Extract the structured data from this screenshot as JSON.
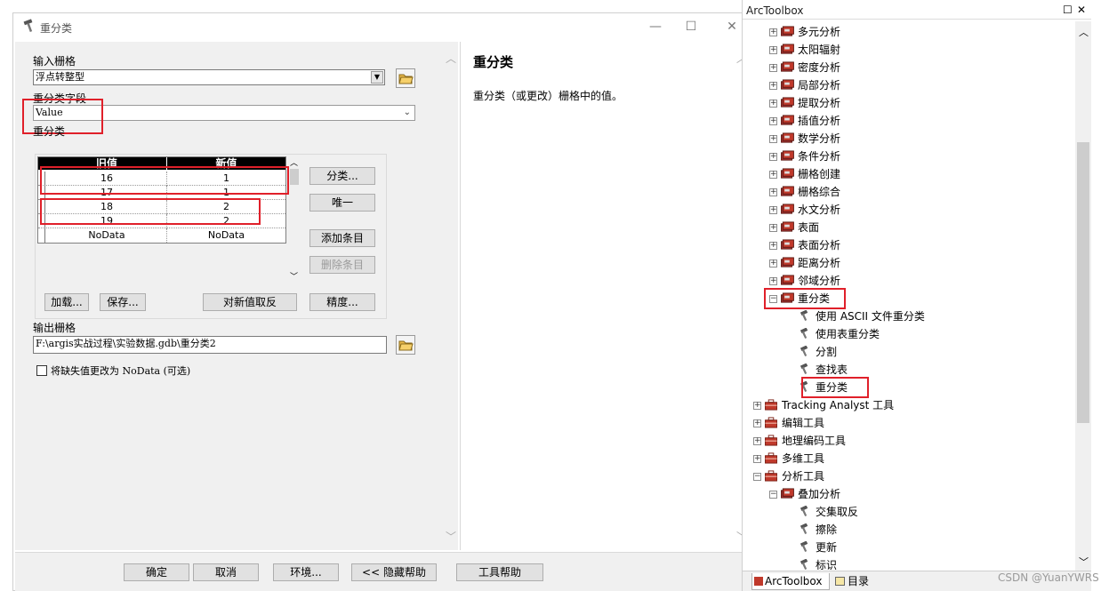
{
  "dialog": {
    "title": "重分类",
    "input_raster_label": "输入栅格",
    "input_raster_value": "浮点转整型",
    "reclass_field_label": "重分类字段",
    "reclass_field_value": "Value",
    "reclassification_label": "重分类",
    "table_headers": [
      "旧值",
      "新值"
    ],
    "table_rows": [
      {
        "old": "16",
        "new": "1"
      },
      {
        "old": "17",
        "new": "1"
      },
      {
        "old": "18",
        "new": "2"
      },
      {
        "old": "19",
        "new": "2"
      },
      {
        "old": "NoData",
        "new": "NoData"
      }
    ],
    "buttons": {
      "classify": "分类...",
      "unique": "唯一",
      "add_entry": "添加条目",
      "delete_entry": "删除条目",
      "load": "加载...",
      "save": "保存...",
      "reverse": "对新值取反",
      "precision": "精度..."
    },
    "output_raster_label": "输出栅格",
    "output_raster_value": "F:\\argis实战过程\\实验数据.gdb\\重分类2",
    "nodata_checkbox_label": "将缺失值更改为 NoData (可选)",
    "nodata_checked": false,
    "help_title": "重分类",
    "help_text": "重分类（或更改）栅格中的值。",
    "bottom_buttons": {
      "ok": "确定",
      "cancel": "取消",
      "env": "环境...",
      "hide_help": "<< 隐藏帮助",
      "tool_help": "工具帮助"
    }
  },
  "arctoolbox": {
    "title": "ArcToolbox",
    "items": [
      {
        "label": "多元分析",
        "kind": "toolset",
        "state": "collapsed"
      },
      {
        "label": "太阳辐射",
        "kind": "toolset",
        "state": "collapsed"
      },
      {
        "label": "密度分析",
        "kind": "toolset",
        "state": "collapsed"
      },
      {
        "label": "局部分析",
        "kind": "toolset",
        "state": "collapsed"
      },
      {
        "label": "提取分析",
        "kind": "toolset",
        "state": "collapsed"
      },
      {
        "label": "插值分析",
        "kind": "toolset",
        "state": "collapsed"
      },
      {
        "label": "数学分析",
        "kind": "toolset",
        "state": "collapsed"
      },
      {
        "label": "条件分析",
        "kind": "toolset",
        "state": "collapsed"
      },
      {
        "label": "栅格创建",
        "kind": "toolset",
        "state": "collapsed"
      },
      {
        "label": "栅格综合",
        "kind": "toolset",
        "state": "collapsed"
      },
      {
        "label": "水文分析",
        "kind": "toolset",
        "state": "collapsed"
      },
      {
        "label": "表面",
        "kind": "toolset",
        "state": "collapsed"
      },
      {
        "label": "表面分析",
        "kind": "toolset",
        "state": "collapsed"
      },
      {
        "label": "距离分析",
        "kind": "toolset",
        "state": "collapsed"
      },
      {
        "label": "邻域分析",
        "kind": "toolset",
        "state": "collapsed"
      },
      {
        "label": "重分类",
        "kind": "toolset",
        "state": "expanded"
      },
      {
        "label": "使用 ASCII 文件重分类",
        "kind": "tool"
      },
      {
        "label": "使用表重分类",
        "kind": "tool"
      },
      {
        "label": "分割",
        "kind": "tool"
      },
      {
        "label": "查找表",
        "kind": "tool"
      },
      {
        "label": "重分类",
        "kind": "tool"
      },
      {
        "label": "Tracking Analyst 工具",
        "kind": "toolbox",
        "state": "collapsed"
      },
      {
        "label": "编辑工具",
        "kind": "toolbox",
        "state": "collapsed"
      },
      {
        "label": "地理编码工具",
        "kind": "toolbox",
        "state": "collapsed"
      },
      {
        "label": "多维工具",
        "kind": "toolbox",
        "state": "collapsed"
      },
      {
        "label": "分析工具",
        "kind": "toolbox",
        "state": "expanded"
      },
      {
        "label": "叠加分析",
        "kind": "toolset",
        "state": "expanded"
      },
      {
        "label": "交集取反",
        "kind": "tool"
      },
      {
        "label": "擦除",
        "kind": "tool"
      },
      {
        "label": "更新",
        "kind": "tool"
      },
      {
        "label": "标识",
        "kind": "tool"
      }
    ],
    "tabs": [
      "ArcToolbox",
      "目录"
    ]
  },
  "watermark": "CSDN @YuanYWRS",
  "colors": {
    "highlight_red": "#e0202a",
    "panel_bg": "#f0f0f0",
    "toolbox_red": "#c0392b"
  }
}
